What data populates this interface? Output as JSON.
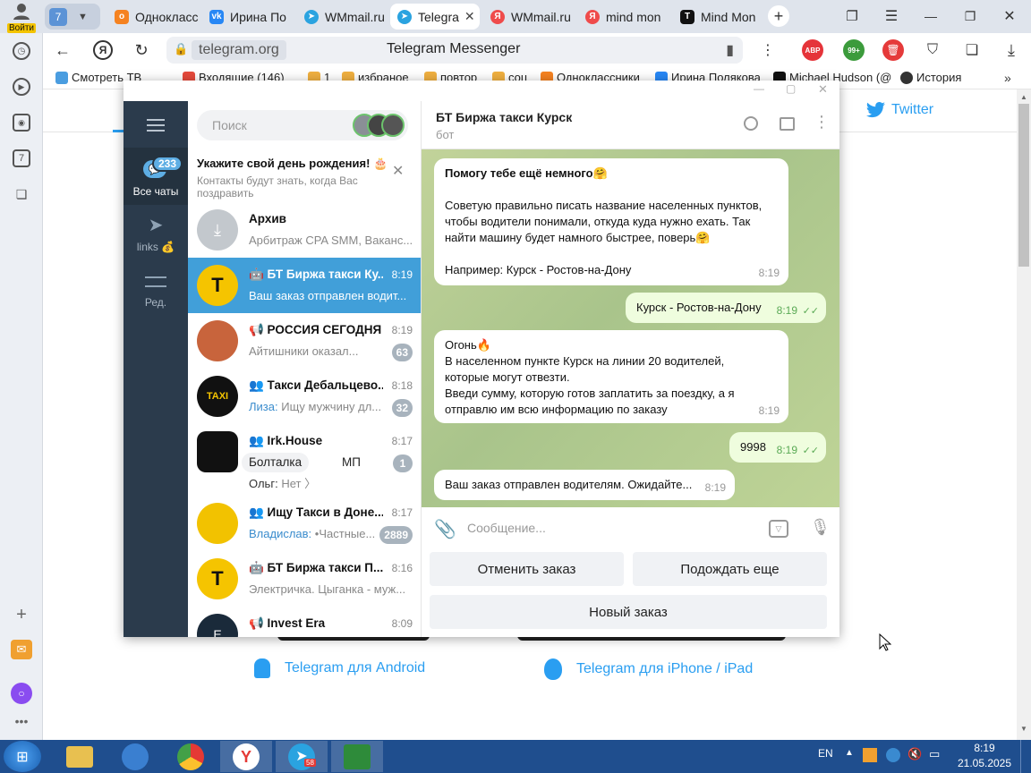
{
  "browser": {
    "profile_label": "Войти",
    "tab_count": "7",
    "tabs": [
      {
        "label": "Однокласс",
        "color": "#f58220"
      },
      {
        "label": "Ирина По",
        "color": "#2787f5"
      },
      {
        "label": "WMmail.ru",
        "color": "#2aa3e0"
      },
      {
        "label": "Telegra",
        "color": "#2aa3e0"
      },
      {
        "label": "WMmail.ru",
        "color": "#ef4b4b"
      },
      {
        "label": "mind mon",
        "color": "#ef4b4b"
      },
      {
        "label": "Mind Mon",
        "color": "#111111"
      }
    ],
    "address": "telegram.org",
    "page_title": "Telegram Messenger",
    "abp_label": "ABP",
    "ext_badge": "99+",
    "bookmarks": [
      {
        "label": "Смотреть ТВ",
        "color": "#4a9de0"
      },
      {
        "label": "Входящие (146)",
        "color": "#e64a3c"
      },
      {
        "label": "1",
        "color": "#f0b040"
      },
      {
        "label": "избраное",
        "color": "#f0b040"
      },
      {
        "label": "повтор",
        "color": "#f0b040"
      },
      {
        "label": "соц",
        "color": "#f0b040"
      },
      {
        "label": "Одноклассники",
        "color": "#f58220"
      },
      {
        "label": "Ирина Полякова",
        "color": "#2787f5"
      },
      {
        "label": "Michael Hudson (@",
        "color": "#111111"
      },
      {
        "label": "История",
        "color": "#333333"
      }
    ]
  },
  "webpage": {
    "twitter_label": "Twitter",
    "android_link": "Telegram для Android",
    "ios_link": "Telegram для iPhone / iPad"
  },
  "telegram": {
    "sidebar": {
      "all_chats_label": "Все чаты",
      "all_chats_badge": "233",
      "links_label": "links 💰",
      "edit_label": "Ред."
    },
    "search_placeholder": "Поиск",
    "birthday": {
      "title": "Укажите свой день рождения! 🎂",
      "text": "Контакты будут знать, когда Вас поздравить"
    },
    "chats": [
      {
        "name": "Архив",
        "time": "",
        "preview": "Арбитраж CPA SMM, Ваканс...",
        "badge": "",
        "avatar": "#c3c8cd"
      },
      {
        "name": "🤖 БТ Биржа такси Ку...",
        "time": "8:19",
        "preview": "Ваш заказ отправлен водит...",
        "badge": "",
        "avatar": "#f5c400"
      },
      {
        "name": "📢 РОССИЯ СЕГОДНЯ",
        "time": "8:19",
        "preview": "Айтишники оказал...",
        "badge": "63",
        "avatar": "#c8643c"
      },
      {
        "name": "👥 Такси Дебальцево...",
        "time": "8:18",
        "preview": "Ищу мужчину дл...",
        "sender": "Лиза:",
        "badge": "32",
        "avatar": "#111111"
      },
      {
        "name": "👥 Irk.House",
        "time": "8:17",
        "preview": "Нет 〉",
        "sender": "Ольг:",
        "badge": "1",
        "avatar": "#111111",
        "chip1": "Болталка",
        "chip2": "МП"
      },
      {
        "name": "👥 Ищу Такси в Доне...",
        "time": "8:17",
        "preview": "•Частные...",
        "sender": "Владислав:",
        "badge": "2889",
        "avatar": "#f2c200"
      },
      {
        "name": "🤖 БТ Биржа такси П...",
        "time": "8:16",
        "preview": "Электричка. Цыганка - муж...",
        "badge": "",
        "avatar": "#f5c400"
      },
      {
        "name": "📢 Invest Era",
        "time": "8:09",
        "preview": "",
        "badge": "",
        "avatar": "#1a2a3a"
      }
    ],
    "header": {
      "title": "БТ Биржа такси Курск",
      "subtitle": "бот"
    },
    "messages": [
      {
        "lines": [
          "Помогу тебе ещё немного🤗",
          "",
          "Советую правильно писать название населенных пунктов,",
          "чтобы водители понимали, откуда куда нужно ехать. Так",
          "найти машину будет намного быстрее, поверь🤗",
          "",
          "Например: Курск - Ростов-на-Дону"
        ],
        "time": "8:19"
      },
      {
        "text": "Курск - Ростов-на-Дону",
        "time": "8:19"
      },
      {
        "lines": [
          "Огонь🔥",
          "В населенном пункте Курск на линии 20  водителей,",
          "которые могут отвезти.",
          "Введи сумму, которую готов заплатить за поездку, а я",
          "отправлю им всю информацию по заказу"
        ],
        "time": "8:19"
      },
      {
        "text": "9998",
        "time": "8:19"
      },
      {
        "text": "Ваш заказ отправлен водителям. Ожидайте...",
        "time": "8:19"
      }
    ],
    "composer_placeholder": "Сообщение...",
    "keyboard": {
      "cancel": "Отменить заказ",
      "wait": "Подождать еще",
      "new": "Новый заказ"
    }
  },
  "taskbar": {
    "lang": "EN",
    "time": "8:19",
    "date": "21.05.2025",
    "telegram_badge": "58"
  }
}
